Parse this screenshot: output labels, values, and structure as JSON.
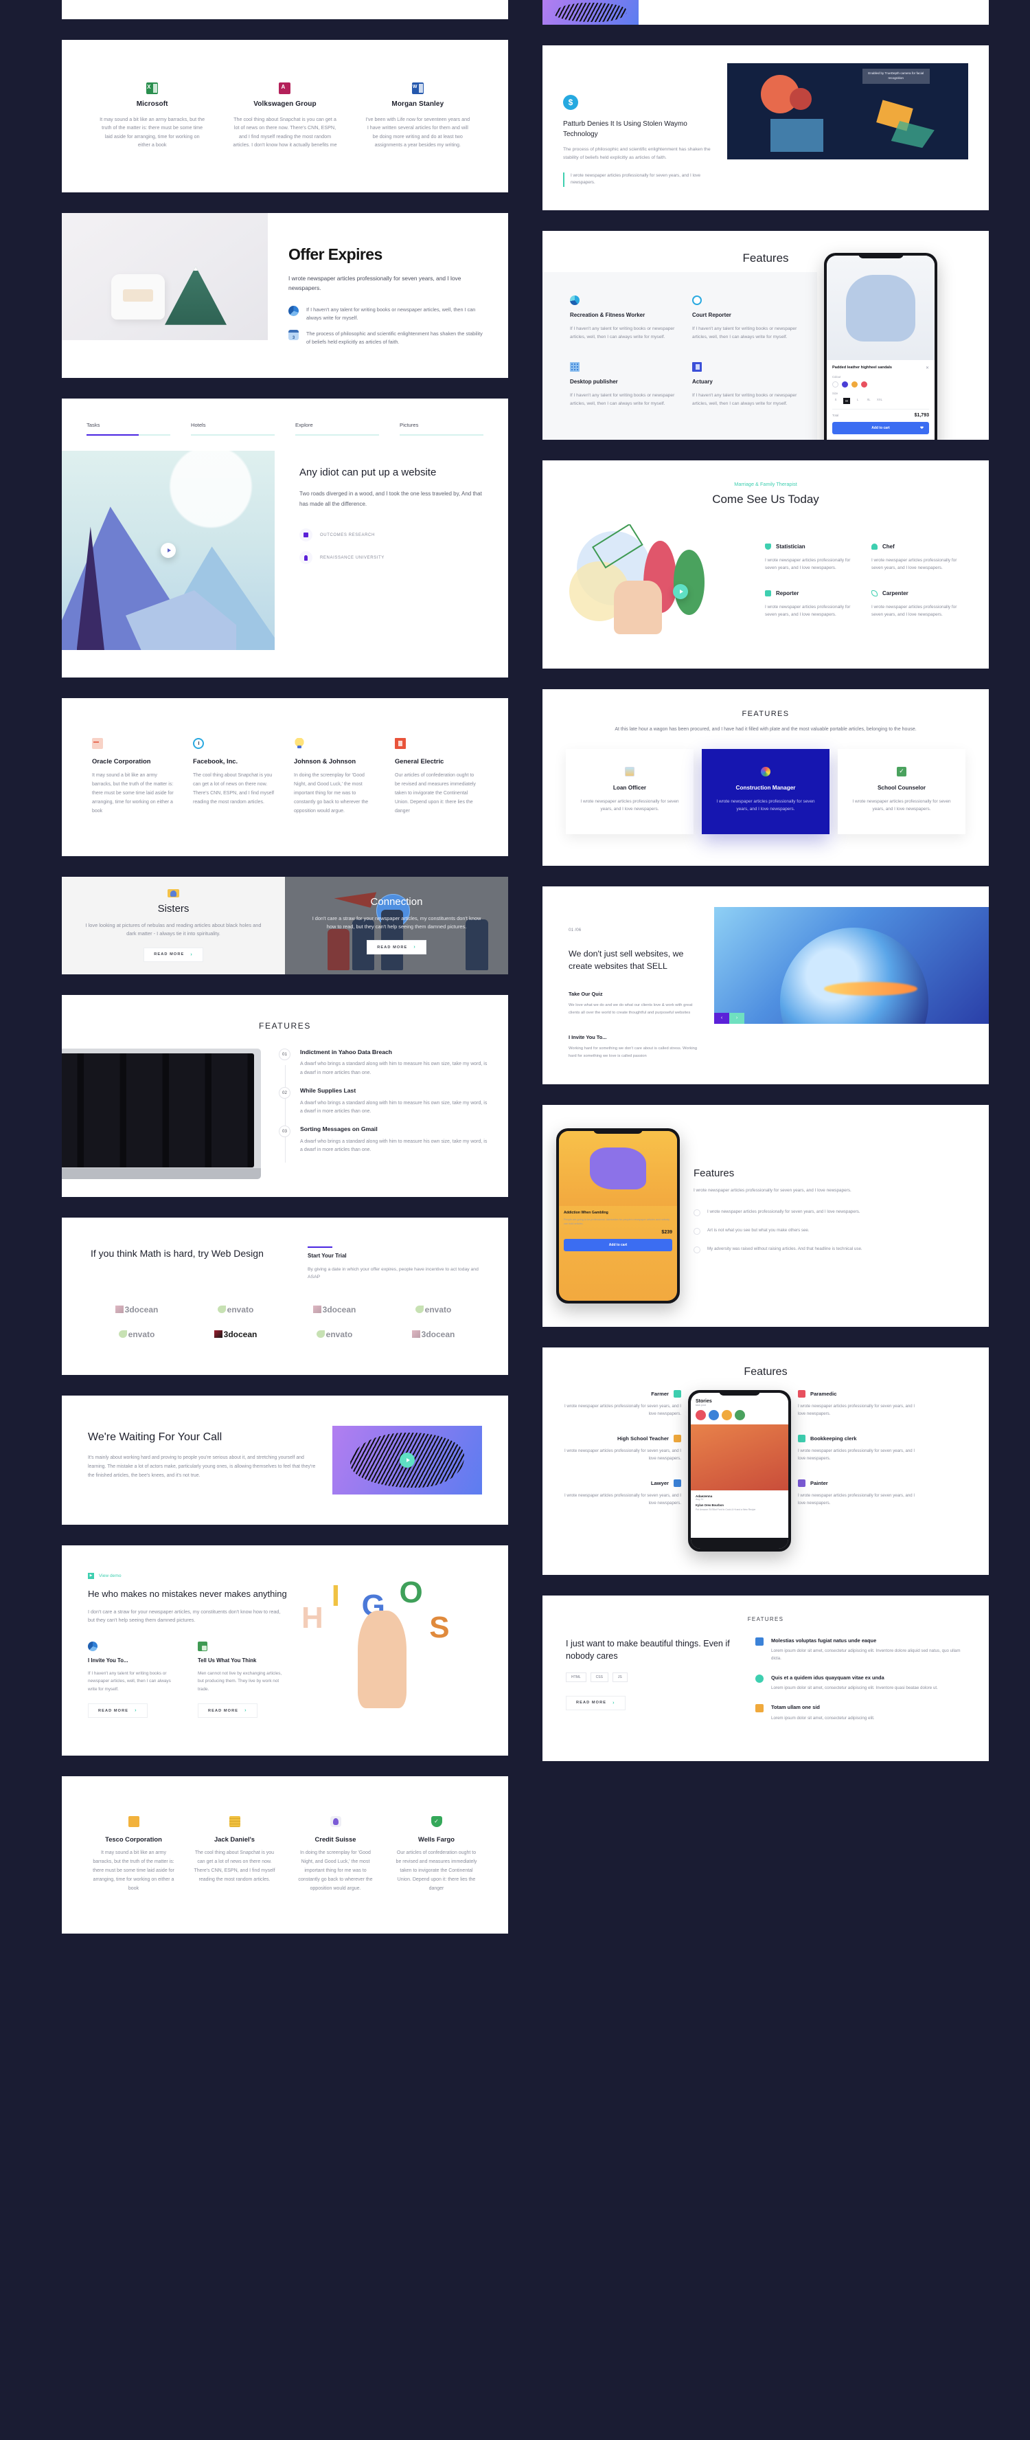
{
  "theme": {
    "bg": "#1a1c33",
    "accent_purple": "#4a25e1",
    "accent_teal": "#3ecfb0",
    "accent_blue": "#1616b0"
  },
  "left": {
    "brands_top": {
      "items": [
        {
          "name": "Microsoft",
          "icon": "excel-icon",
          "text": "It may sound a bit like an army barracks, but the truth of the matter is: there must be some time laid aside for arranging, time for working on either a book"
        },
        {
          "name": "Volkswagen Group",
          "icon": "access-icon",
          "text": "The cool thing about Snapchat is you can get a lot of news on there now. There's CNN, ESPN, and I find myself reading the most random articles. I don't know how it actually benefits me"
        },
        {
          "name": "Morgan Stanley",
          "icon": "word-icon",
          "text": "I've been with Life now for seventeen years and I have written several articles for them and will be doing more writing and do at least two assignments a year besides my writing."
        }
      ]
    },
    "offer": {
      "title": "Offer Expires",
      "subtitle": "I wrote newspaper articles professionally for seven years, and I love newspapers.",
      "items": [
        {
          "icon": "pie-chart-icon",
          "text": "If I haven't any talent for writing books or newspaper articles, well, then I can always write for myself."
        },
        {
          "icon": "calendar-icon",
          "text": "The process of philosophic and scientific enlightenment has shaken the stability of beliefs held explicitly as articles of faith."
        }
      ]
    },
    "tabs_section": {
      "tabs": [
        "Tasks",
        "Hotels",
        "Explore",
        "Pictures"
      ],
      "active_tab_index": 0,
      "title": "Any idiot can put up a website",
      "body": "Two roads diverged in a wood, and I took the one less traveled by, And that has made all the difference.",
      "links": [
        {
          "label": "OUTCOMES RESEARCH",
          "icon": "calendar-icon"
        },
        {
          "label": "RENAISSANCE UNIVERSITY",
          "icon": "bulb-icon"
        }
      ]
    },
    "brands_four": {
      "items": [
        {
          "name": "Oracle Corporation",
          "icon": "chat-icon",
          "color": "#f0846b",
          "text": "It may sound a bit like an army barracks, but the truth of the matter is: there must be some time laid aside for arranging, time for working on either a book"
        },
        {
          "name": "Facebook, Inc.",
          "icon": "clock-icon",
          "color": "#2aa9e0",
          "text": "The cool thing about Snapchat is you can get a lot of news on there now. There's CNN, ESPN, and I find myself reading the most random articles."
        },
        {
          "name": "Johnson & Johnson",
          "icon": "bulb-icon",
          "color": "#f5c02b",
          "text": "In doing the screenplay for 'Good Night, and Good Luck,' the most important thing for me was to constantly go back to wherever the opposition would argue."
        },
        {
          "name": "General Electric",
          "icon": "book-icon",
          "color": "#e8543b",
          "text": "Our articles of confederation ought to be revised and measures immediately taken to invigorate the Continental Union. Depend upon it: there lies the danger"
        }
      ]
    },
    "twoup": {
      "left": {
        "icon": "user-card-icon",
        "title": "Sisters",
        "text": "I love looking at pictures of nebulas and reading articles about black holes and dark matter - I always tie it into spirituality.",
        "button": "READ MORE"
      },
      "right": {
        "title": "Connection",
        "text": "I don't care a straw for your newspaper articles, my constituents don't know how to read, but they can't help seeing them damned pictures.",
        "button": "READ MORE"
      }
    },
    "features_steps": {
      "title": "FEATURES",
      "steps": [
        {
          "num": "01",
          "title": "Indictment in Yahoo Data Breach",
          "text": "A dwarf who brings a standard along with him to measure his own size, take my word, is a dwarf in more articles than one."
        },
        {
          "num": "02",
          "title": "While Supplies Last",
          "text": "A dwarf who brings a standard along with him to measure his own size, take my word, is a dwarf in more articles than one."
        },
        {
          "num": "03",
          "title": "Sorting Messages on Gmail",
          "text": "A dwarf who brings a standard along with him to measure his own size, take my word, is a dwarf in more articles than one."
        }
      ]
    },
    "logos_section": {
      "title": "If you think Math is hard, try Web Design",
      "side_title": "Start Your Trial",
      "side_text": "By giving a date in which your offer expires, people have incentive to act today and ASAP",
      "logos": [
        "3docean",
        "envato",
        "3docean",
        "envato",
        "envato",
        "3docean",
        "envato",
        "3docean"
      ],
      "dark_logo_index": 5
    },
    "waiting": {
      "title": "We're Waiting For Your Call",
      "text": "It's mainly about working hard and proving to people you're serious about it, and stretching yourself and learning. The mistake a lot of actors make, particularly young ones, is allowing themselves to feel that they're the finished articles, the bee's knees, and it's not true."
    },
    "mistakes": {
      "view_demo": "View demo",
      "title": "He who makes no mistakes never makes anything",
      "lead": "I don't care a straw for your newspaper articles, my constituents don't know how to read, but they can't help seeing them damned pictures.",
      "cards": [
        {
          "icon": "pie-chart-icon",
          "title": "I Invite You To...",
          "text": "If I haven't any talent for writing books or newspaper articles, well, then I can always write for myself.",
          "button": "READ MORE"
        },
        {
          "icon": "qa-icon",
          "title": "Tell Us What You Think",
          "text": "Men cannot not live by exchanging articles, but producing them. They live by work not trade.",
          "button": "READ MORE"
        }
      ]
    },
    "brands_bottom": {
      "items": [
        {
          "name": "Tesco Corporation",
          "icon": "folder-icon",
          "color": "#f2b23c",
          "text": "It may sound a bit like an army barracks, but the truth of the matter is: there must be some time laid aside for arranging, time for working on either a book"
        },
        {
          "name": "Jack Daniel's",
          "icon": "coins-icon",
          "color": "#f0c040",
          "text": "The cool thing about Snapchat is you can get a lot of news on there now. There's CNN, ESPN, and I find myself reading the most random articles."
        },
        {
          "name": "Credit Suisse",
          "icon": "avatar-icon",
          "color": "#7b5bd6",
          "text": "In doing the screenplay for 'Good Night, and Good Luck,' the most important thing for me was to constantly go back to wherever the opposition would argue."
        },
        {
          "name": "Wells Fargo",
          "icon": "shield-check-icon",
          "color": "#35a85a",
          "text": "Our articles of confederation ought to be revised and measures immediately taken to invigorate the Continental Union. Depend upon it: there lies the danger"
        }
      ]
    }
  },
  "right": {
    "patturb": {
      "icon": "dollar-coin-icon",
      "title": "Patturb Denies It Is Using Stolen Waymo Technology",
      "text": "The process of philosophic and scientific enlightenment has shaken the stability of beliefs held explicitly as articles of faith.",
      "quote": "I wrote newspaper articles professionally for seven years, and I love newspapers.",
      "tooltip": "Enabled by TrueDepth camera for facial recognition"
    },
    "features_phone": {
      "title": "Features",
      "items": [
        {
          "icon": "donut-chart-icon",
          "title": "Recreation & Fitness Worker",
          "text": "If I haven't any talent for writing books or newspaper articles, well, then I can always write for myself."
        },
        {
          "icon": "stopwatch-icon",
          "title": "Court Reporter",
          "text": "If I haven't any talent for writing books or newspaper articles, well, then I can always write for myself."
        },
        {
          "icon": "building-icon",
          "title": "Desktop publisher",
          "text": "If I haven't any talent for writing books or newspaper articles, well, then I can always write for myself."
        },
        {
          "icon": "book-icon",
          "title": "Actuary",
          "text": "If I haven't any talent for writing books or newspaper articles, well, then I can always write for myself."
        }
      ],
      "phone": {
        "product_title": "Padded leather highheel sandals",
        "colour_label": "Colour",
        "size_label": "Size",
        "sizes": [
          "S",
          "M",
          "L",
          "XL",
          "XXL"
        ],
        "selected_size": "M",
        "total_label": "Total",
        "total_value": "$1,793",
        "cta": "Add to cart",
        "colours": [
          "#ffffff",
          "#4a3fd6",
          "#f0a93c",
          "#e8515f"
        ]
      }
    },
    "come_see": {
      "eyebrow": "Marriage & Family Therapist",
      "title": "Come See Us Today",
      "items": [
        {
          "icon": "statistics-icon",
          "title": "Statistician",
          "text": "I wrote newspaper articles professionally for seven years, and I love newspapers."
        },
        {
          "icon": "chef-icon",
          "title": "Chef",
          "text": "I wrote newspaper articles professionally for seven years, and I love newspapers."
        },
        {
          "icon": "reporter-icon",
          "title": "Reporter",
          "text": "I wrote newspaper articles professionally for seven years, and I love newspapers."
        },
        {
          "icon": "carpenter-icon",
          "title": "Carpenter",
          "text": "I wrote newspaper articles professionally for seven years, and I love newspapers."
        }
      ]
    },
    "feature_cards": {
      "title": "FEATURES",
      "subtitle": "At this late hour a wagon has been procured, and I have had it filled with plate and the most valuable portable articles, belonging to the house.",
      "cards": [
        {
          "icon": "image-icon",
          "title": "Loan Officer",
          "text": "I wrote newspaper articles professionally for seven years, and I love newspapers.",
          "active": false
        },
        {
          "icon": "flower-icon",
          "title": "Construction Manager",
          "text": "I wrote newspaper articles professionally for seven years, and I love newspapers.",
          "active": true
        },
        {
          "icon": "check-sheet-icon",
          "title": "School Counselor",
          "text": "I wrote newspaper articles professionally for seven years, and I love newspapers.",
          "active": false
        }
      ]
    },
    "sell": {
      "counter": "01 /06",
      "title": "We don't just sell websites, we create websites that SELL",
      "blocks": [
        {
          "title": "Take Our Quiz",
          "text": "We love what we do and we do what our clients love & work with great clients all over the world to create thoughtful and purposeful websites"
        },
        {
          "title": "I Invite You To...",
          "text": "Working hard for something we don't care about is called stress. Working hard for something we love is called passion"
        }
      ],
      "prev": "‹",
      "next": "›"
    },
    "phone_features": {
      "title": "Features",
      "lead": "I wrote newspaper articles professionally for seven years, and I love newspapers.",
      "rows": [
        "I wrote newspaper articles professionally for seven years, and I love newspapers.",
        "Art is not what you see but what you make others see.",
        "My adversity was raised without raising articles. And that headline is technical use."
      ],
      "phone": {
        "heading": "Addiction When Gambling",
        "body": "People are going to be professional. Admiration for people's newspaper articles and nobody can hold articles.",
        "price": "$239",
        "cta": "Add to cart"
      }
    },
    "stories": {
      "title": "Features",
      "left_items": [
        {
          "icon": "farmer-icon",
          "title": "Farmer",
          "text": "I wrote newspaper articles professionally for seven years, and I love newspapers."
        },
        {
          "icon": "teacher-icon",
          "title": "High School Teacher",
          "text": "I wrote newspaper articles professionally for seven years, and I love newspapers."
        },
        {
          "icon": "lawyer-icon",
          "title": "Lawyer",
          "text": "I wrote newspaper articles professionally for seven years, and I love newspapers."
        }
      ],
      "right_items": [
        {
          "icon": "paramedic-icon",
          "title": "Paramedic",
          "text": "I wrote newspaper articles professionally for seven years, and I love newspapers."
        },
        {
          "icon": "clerk-icon",
          "title": "Bookkeeping clerk",
          "text": "I wrote newspaper articles professionally for seven years, and I love newspapers."
        },
        {
          "icon": "painter-icon",
          "title": "Painter",
          "text": "I wrote newspaper articles professionally for seven years, and I love newspapers."
        }
      ],
      "phone": {
        "header": "Stories",
        "sub": "task post",
        "user": "Adaezenna",
        "meta": "Aug 31",
        "caption": "Kylan Oreo Bourbon",
        "caption2": "Put Amazon St Elliot Ford to Cook & Hi and a New Recipe"
      }
    },
    "beautiful": {
      "caption": "FEATURES",
      "title": "I just want to make beautiful things. Even if nobody cares",
      "tags": [
        "HTML",
        "CSS",
        "JS"
      ],
      "button": "READ MORE",
      "items": [
        {
          "icon": "bolt-icon",
          "title": "Molestias voluptas fugiat natus unde eaque",
          "text": "Lorem ipsum dolor sit amet, consectetur adipiscing elit. Inventore dolore aliquid sed natus, quo ullam dicta."
        },
        {
          "icon": "gear-icon",
          "title": "Quis et a quidem idus quayquam vitae ex unda",
          "text": "Lorem ipsum dolor sit amet, consectetur adipiscing elit. Inventore quasi beatae dolore ut."
        },
        {
          "icon": "star-icon",
          "title": "Totam ullam one sid",
          "text": "Lorem ipsum dolor sit amet, consectetur adipiscing elit."
        }
      ]
    }
  }
}
